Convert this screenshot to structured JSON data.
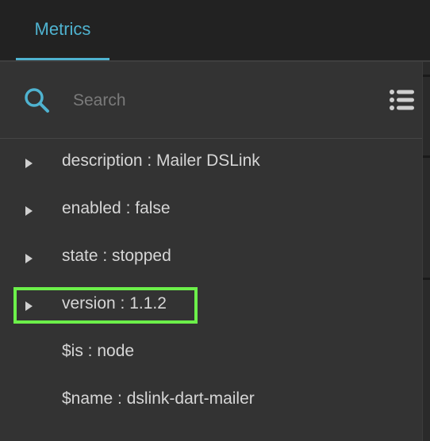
{
  "tabs": [
    {
      "label": "Metrics",
      "active": true
    }
  ],
  "search": {
    "placeholder": "Search",
    "value": ""
  },
  "icons": {
    "search": "search-icon",
    "list": "list-menu-icon",
    "expand": "triangle-right-icon"
  },
  "colors": {
    "accent": "#4fb3d0",
    "highlight": "#6cf04a",
    "background": "#333333",
    "tabbar": "#222222",
    "text": "#d6d6d6"
  },
  "tree": {
    "items": [
      {
        "label": "description : Mailer DSLink",
        "expandable": true
      },
      {
        "label": "enabled : false",
        "expandable": true
      },
      {
        "label": "state : stopped",
        "expandable": true
      },
      {
        "label": "version : 1.1.2",
        "expandable": true,
        "highlighted": true
      },
      {
        "label": "$is : node",
        "expandable": false
      },
      {
        "label": "$name : dslink-dart-mailer",
        "expandable": false
      }
    ]
  }
}
